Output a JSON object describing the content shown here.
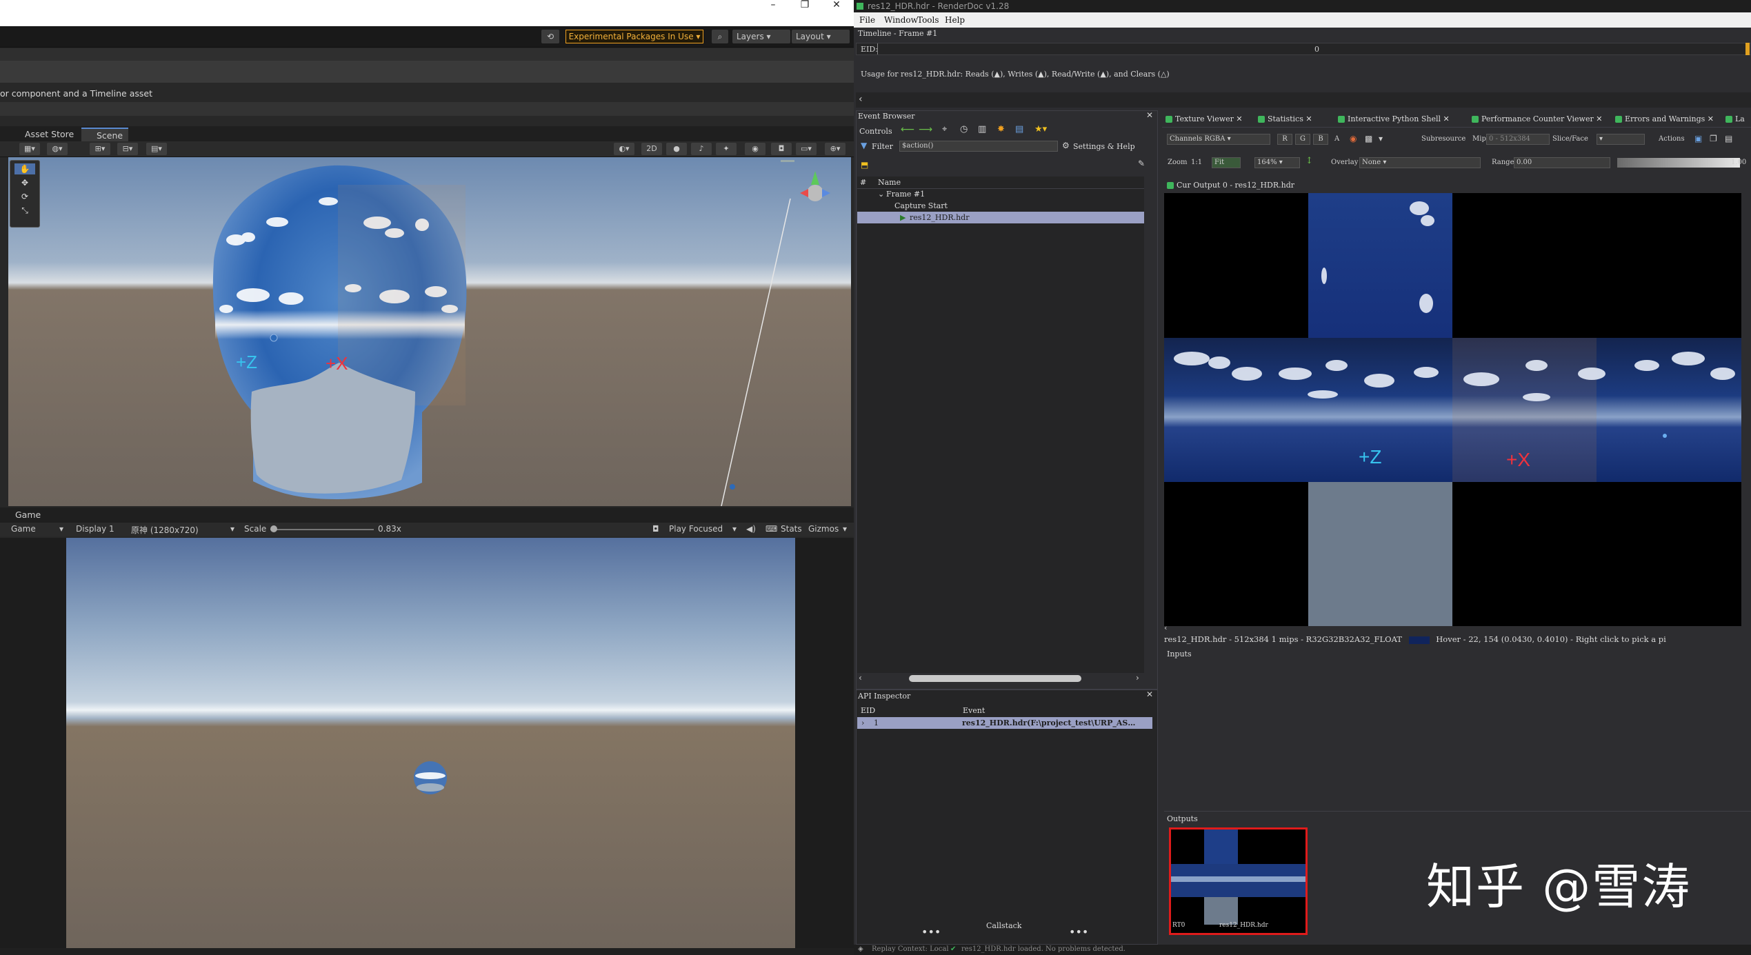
{
  "unity": {
    "window_buttons": [
      "–",
      "❐",
      "✕"
    ],
    "toolbar": {
      "experimental": "Experimental Packages In Use ▾",
      "layers": "Layers",
      "layout": "Layout"
    },
    "inspector_text": "or component and a Timeline asset",
    "tabs": {
      "asset_store": "Asset Store",
      "scene": "Scene"
    },
    "scene_tools": [
      "2D"
    ],
    "scene_labels": {
      "plus_z": "+Z",
      "plus_x": "+X"
    },
    "game": {
      "tab": "Game",
      "dropdown": "Game",
      "display": "Display 1",
      "resolution": "原神 (1280x720)",
      "scale_label": "Scale",
      "scale_value": "0.83x",
      "play_focused": "Play Focused",
      "stats": "Stats",
      "gizmos": "Gizmos"
    },
    "colors": {
      "accent": "#f0a020",
      "tab_highlight": "#5a8ad0"
    }
  },
  "renderdoc": {
    "title": "res12_HDR.hdr - RenderDoc v1.28",
    "menu": [
      "File",
      "Window",
      "Tools",
      "Help"
    ],
    "timeline_label": "Timeline - Frame #1",
    "eid_label": "EID:",
    "eid_value": "0",
    "usage_text": "Usage for res12_HDR.hdr: Reads (▲), Writes (▲), Read/Write (▲), and Clears (△)",
    "event_browser": {
      "title": "Event Browser",
      "controls": "Controls",
      "filter_label": "Filter",
      "filter_value": "$action()",
      "settings": "Settings & Help",
      "columns": [
        "#",
        "Name"
      ],
      "rows": [
        "Frame #1",
        "Capture Start",
        "res12_HDR.hdr"
      ]
    },
    "api_inspector": {
      "title": "API Inspector",
      "columns": [
        "EID",
        "Event"
      ],
      "row_eid": "1",
      "row_event": "res12_HDR.hdr(F:\\project_test\\URP_AS…",
      "callstack": "Callstack"
    },
    "tabs": [
      "Texture Viewer",
      "Statistics",
      "Interactive Python Shell",
      "Performance Counter Viewer",
      "Errors and Warnings",
      "La"
    ],
    "texture_viewer": {
      "channels": "Channels RGBA",
      "rgba": [
        "R",
        "G",
        "B",
        "A"
      ],
      "subresource": "Subresource",
      "mip": "Mip",
      "mip_value": "0 - 512x384",
      "slice_face": "Slice/Face",
      "actions": "Actions",
      "zoom_label": "Zoom",
      "zoom_ratio": "1:1",
      "fit": "Fit",
      "zoom_value": "164%",
      "overlay_label": "Overlay",
      "overlay_value": "None",
      "range_label": "Range",
      "range_min": "0.00",
      "range_max": "1.00",
      "output_tab": "Cur Output 0 - res12_HDR.hdr",
      "info": "res12_HDR.hdr - 512x384 1 mips - R32G32B32A32_FLOAT",
      "hover": "Hover -    22,  154 (0.0430, 0.4010)  - Right click to pick a pi",
      "inputs": "Inputs",
      "outputs": "Outputs",
      "thumb_left": "RT0",
      "thumb_right": "res12_HDR.hdr",
      "labels": {
        "plus_z": "+Z",
        "plus_x": "+X"
      }
    },
    "status": "Replay Context: Local",
    "status_msg": "res12_HDR.hdr loaded. No problems detected.",
    "watermark": "知乎 @雪涛",
    "colors": {
      "selection": "#9aa0c4",
      "highlight_border": "#e01b1b"
    }
  }
}
